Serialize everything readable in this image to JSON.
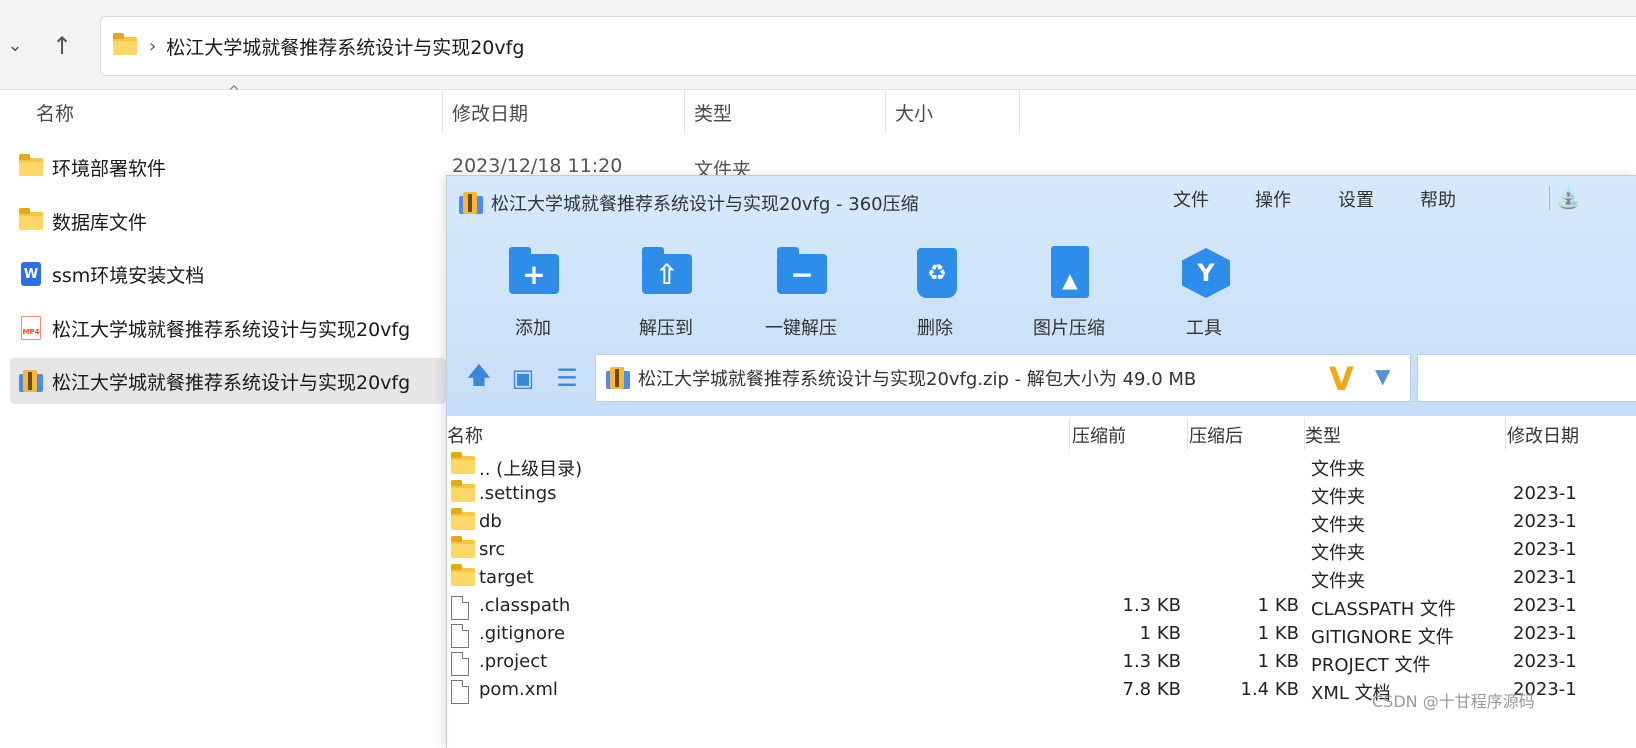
{
  "explorer": {
    "breadcrumb": "松江大学城就餐推荐系统设计与实现20vfg",
    "columns": {
      "name": "名称",
      "modified": "修改日期",
      "type": "类型",
      "size": "大小"
    },
    "items": [
      {
        "name": "环境部署软件",
        "icon": "folder-icon"
      },
      {
        "name": "数据库文件",
        "icon": "folder-icon"
      },
      {
        "name": "ssm环境安装文档",
        "icon": "word-doc-icon"
      },
      {
        "name": "松江大学城就餐推荐系统设计与实现20vfg",
        "icon": "mp4-icon"
      },
      {
        "name": "松江大学城就餐推荐系统设计与实现20vfg",
        "icon": "zip-archive-icon",
        "selected": true
      }
    ],
    "first_item_meta": {
      "modified": "2023/12/18 11:20",
      "type": "文件夹"
    }
  },
  "archiver": {
    "title": "松江大学城就餐推荐系统设计与实现20vfg - 360压缩",
    "menu": [
      "文件",
      "操作",
      "设置",
      "帮助"
    ],
    "tools": [
      {
        "label": "添加",
        "icon": "add-folder-icon"
      },
      {
        "label": "解压到",
        "icon": "extract-to-icon"
      },
      {
        "label": "一键解压",
        "icon": "one-click-extract-icon"
      },
      {
        "label": "删除",
        "icon": "recycle-bin-icon"
      },
      {
        "label": "图片压缩",
        "icon": "image-compress-icon"
      },
      {
        "label": "工具",
        "icon": "tools-icon"
      }
    ],
    "path": "松江大学城就餐推荐系统设计与实现20vfg.zip - 解包大小为 49.0 MB",
    "columns": {
      "name": "名称",
      "before": "压缩前",
      "after": "压缩后",
      "type": "类型",
      "date": "修改日期"
    },
    "rows": [
      {
        "name": ".. (上级目录)",
        "before": "",
        "after": "",
        "type": "文件夹",
        "date": "",
        "icon": "folder-icon"
      },
      {
        "name": ".settings",
        "before": "",
        "after": "",
        "type": "文件夹",
        "date": "2023-1",
        "icon": "folder-icon"
      },
      {
        "name": "db",
        "before": "",
        "after": "",
        "type": "文件夹",
        "date": "2023-1",
        "icon": "folder-icon"
      },
      {
        "name": "src",
        "before": "",
        "after": "",
        "type": "文件夹",
        "date": "2023-1",
        "icon": "folder-icon"
      },
      {
        "name": "target",
        "before": "",
        "after": "",
        "type": "文件夹",
        "date": "2023-1",
        "icon": "folder-icon"
      },
      {
        "name": ".classpath",
        "before": "1.3 KB",
        "after": "1 KB",
        "type": "CLASSPATH 文件",
        "date": "2023-1",
        "icon": "file-icon"
      },
      {
        "name": ".gitignore",
        "before": "1 KB",
        "after": "1 KB",
        "type": "GITIGNORE 文件",
        "date": "2023-1",
        "icon": "file-icon"
      },
      {
        "name": ".project",
        "before": "1.3 KB",
        "after": "1 KB",
        "type": "PROJECT 文件",
        "date": "2023-1",
        "icon": "file-icon"
      },
      {
        "name": "pom.xml",
        "before": "7.8 KB",
        "after": "1.4 KB",
        "type": "XML 文档",
        "date": "2023-1",
        "icon": "file-icon"
      }
    ]
  },
  "watermark": "CSDN @十甘程序源码",
  "colors": {
    "accent": "#2d8de8",
    "archiver_bg": "#cfe4f9",
    "folder": "#f7c544"
  }
}
